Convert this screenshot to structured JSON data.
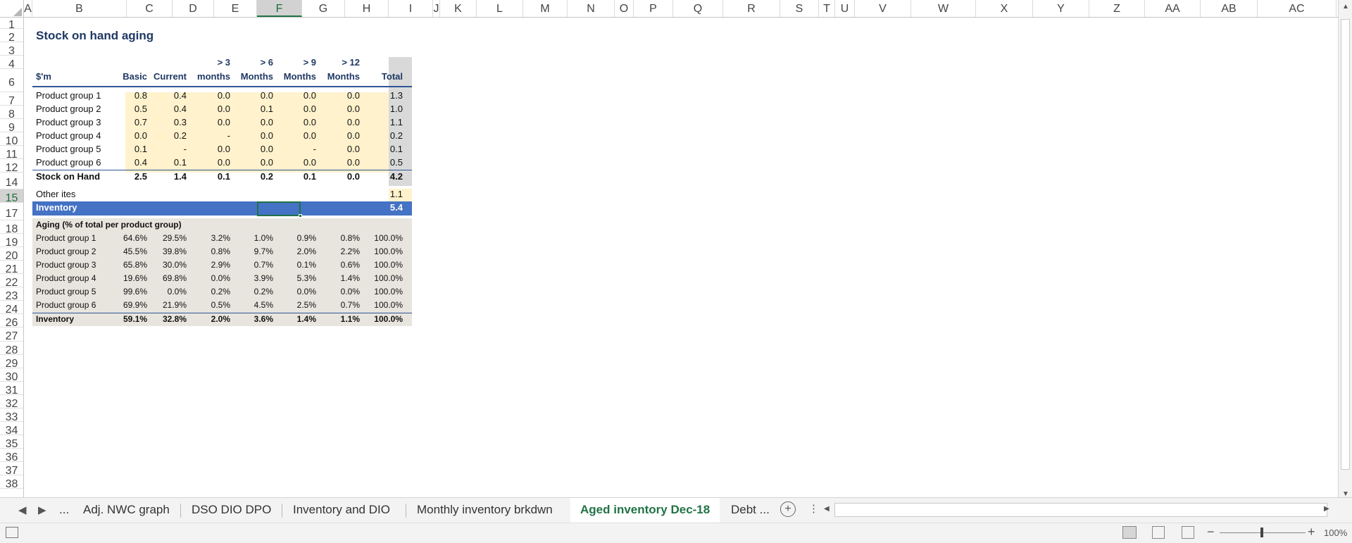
{
  "columns": [
    "A",
    "B",
    "C",
    "D",
    "E",
    "F",
    "G",
    "H",
    "I",
    "J",
    "K",
    "L",
    "M",
    "N",
    "O",
    "P",
    "Q",
    "R",
    "S",
    "T",
    "U",
    "V",
    "W",
    "X",
    "Y",
    "Z",
    "AA",
    "AB",
    "AC"
  ],
  "selected_column": "F",
  "rows": [
    "1",
    "2",
    "3",
    "4",
    "6",
    "7",
    "8",
    "9",
    "10",
    "11",
    "12",
    "14",
    "15",
    "17",
    "18",
    "19",
    "20",
    "21",
    "22",
    "23",
    "24",
    "26",
    "27",
    "28",
    "29",
    "30",
    "31",
    "32",
    "33",
    "34",
    "35",
    "36",
    "37",
    "38"
  ],
  "selected_row": "15",
  "sheet": {
    "title": "Stock on hand aging",
    "header_top": [
      "> 3",
      "> 6",
      "> 9",
      "> 12"
    ],
    "header_unit": "$'m",
    "headers": [
      "Basic",
      "Current",
      "months",
      "Months",
      "Months",
      "Months",
      "Total"
    ],
    "products": [
      {
        "name": "Product group 1",
        "vals": [
          "0.8",
          "0.4",
          "0.0",
          "0.0",
          "0.0",
          "0.0",
          "1.3"
        ]
      },
      {
        "name": "Product group 2",
        "vals": [
          "0.5",
          "0.4",
          "0.0",
          "0.1",
          "0.0",
          "0.0",
          "1.0"
        ]
      },
      {
        "name": "Product group 3",
        "vals": [
          "0.7",
          "0.3",
          "0.0",
          "0.0",
          "0.0",
          "0.0",
          "1.1"
        ]
      },
      {
        "name": "Product group 4",
        "vals": [
          "0.0",
          "0.2",
          "-",
          "0.0",
          "0.0",
          "0.0",
          "0.2"
        ]
      },
      {
        "name": "Product group 5",
        "vals": [
          "0.1",
          "-",
          "0.0",
          "0.0",
          "-",
          "0.0",
          "0.1"
        ]
      },
      {
        "name": "Product group 6",
        "vals": [
          "0.4",
          "0.1",
          "0.0",
          "0.0",
          "0.0",
          "0.0",
          "0.5"
        ]
      }
    ],
    "stock_total": {
      "name": "Stock on Hand",
      "vals": [
        "2.5",
        "1.4",
        "0.1",
        "0.2",
        "0.1",
        "0.0",
        "4.2"
      ]
    },
    "other": {
      "name": "Other ites",
      "val": "1.1"
    },
    "inventory": {
      "name": "Inventory",
      "val": "5.4"
    },
    "aging_title": "Aging (% of total per product group)",
    "aging": [
      {
        "name": "Product group 1",
        "vals": [
          "64.6%",
          "29.5%",
          "3.2%",
          "1.0%",
          "0.9%",
          "0.8%",
          "100.0%"
        ]
      },
      {
        "name": "Product group 2",
        "vals": [
          "45.5%",
          "39.8%",
          "0.8%",
          "9.7%",
          "2.0%",
          "2.2%",
          "100.0%"
        ]
      },
      {
        "name": "Product group 3",
        "vals": [
          "65.8%",
          "30.0%",
          "2.9%",
          "0.7%",
          "0.1%",
          "0.6%",
          "100.0%"
        ]
      },
      {
        "name": "Product group 4",
        "vals": [
          "19.6%",
          "69.8%",
          "0.0%",
          "3.9%",
          "5.3%",
          "1.4%",
          "100.0%"
        ]
      },
      {
        "name": "Product group 5",
        "vals": [
          "99.6%",
          "0.0%",
          "0.2%",
          "0.2%",
          "0.0%",
          "0.0%",
          "100.0%"
        ]
      },
      {
        "name": "Product group 6",
        "vals": [
          "69.9%",
          "21.9%",
          "0.5%",
          "4.5%",
          "2.5%",
          "0.7%",
          "100.0%"
        ]
      }
    ],
    "aging_total": {
      "name": "Inventory",
      "vals": [
        "59.1%",
        "32.8%",
        "2.0%",
        "3.6%",
        "1.4%",
        "1.1%",
        "100.0%"
      ]
    }
  },
  "tabs": {
    "ellipsis": "...",
    "items": [
      "Adj. NWC graph",
      "DSO DIO DPO",
      "Inventory and DIO",
      "Monthly inventory brkdwn",
      "Aged inventory Dec-18",
      "Debt ..."
    ],
    "active": "Aged inventory Dec-18"
  },
  "status": {
    "zoom": "100%"
  },
  "colors": {
    "highlight_yellow": "#fff2cc",
    "total_gray": "#d9d9d9",
    "inventory_blue": "#4472c4",
    "excel_green": "#217346"
  }
}
